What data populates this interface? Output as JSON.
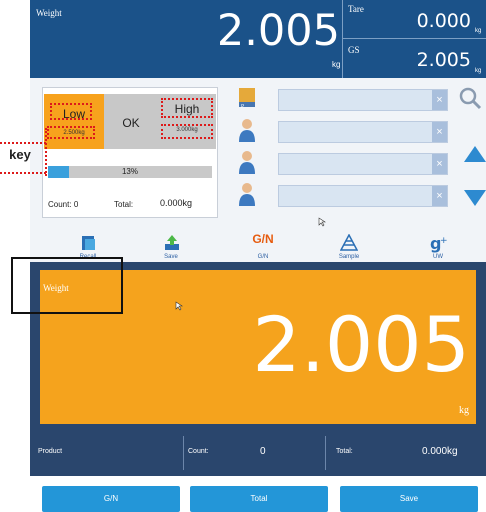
{
  "header": {
    "weight_label": "Weight",
    "weight_value": "2.005",
    "weight_unit": "kg",
    "tare_label": "Tare",
    "tare_value": "0.000",
    "tare_unit": "kg",
    "gs_label": "GS",
    "gs_value": "2.005",
    "gs_unit": "kg"
  },
  "limits": {
    "low_label": "Low",
    "low_value": "2.500kg",
    "ok_label": "OK",
    "high_label": "High",
    "high_value": "3.000kg",
    "low_color": "#f7a21d",
    "inactive_color": "#c8c8c8"
  },
  "annotation": {
    "key_label": "key",
    "highlight_color": "#dd1a1a"
  },
  "progress": {
    "percent_text": "13%",
    "fraction": 0.13
  },
  "counters": {
    "count_label": "Count:",
    "count_value": "0",
    "total_label": "Total:",
    "total_value": "0.000kg"
  },
  "rows": [
    {
      "icon": "product-box-icon"
    },
    {
      "icon": "person-icon"
    },
    {
      "icon": "person-icon"
    },
    {
      "icon": "person-icon"
    }
  ],
  "toolbar": {
    "items": [
      {
        "label": "Recall",
        "icon": "recall-icon"
      },
      {
        "label": "Save",
        "icon": "save-icon"
      },
      {
        "label": "G/N",
        "top": "G/N"
      },
      {
        "label": "Sample",
        "icon": "sample-icon"
      },
      {
        "label": "UW",
        "icon": "uw-icon"
      }
    ]
  },
  "main_display": {
    "label": "Weight",
    "value": "2.005",
    "unit": "kg",
    "color": "#f5a31d"
  },
  "info_strip": {
    "product_label": "Product",
    "count_label": "Count:",
    "count_value": "0",
    "total_label": "Total:",
    "total_value": "0.000kg"
  },
  "buttons": {
    "gn": "G/N",
    "total": "Total",
    "save": "Save",
    "color": "#2396d8"
  }
}
